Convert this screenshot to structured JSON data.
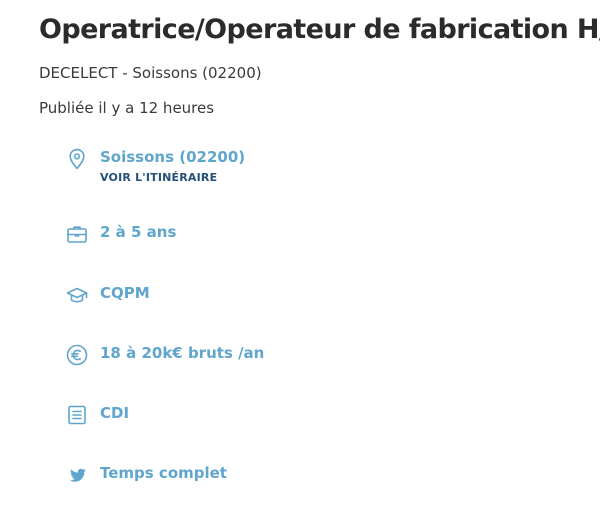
{
  "job": {
    "title": "Operatrice/Operateur de fabrication H/F",
    "company_location": "DECELECT - Soissons (02200)",
    "published": "Publiée il y a 12 heures"
  },
  "details": {
    "location": {
      "icon": "location-pin-icon",
      "value": "Soissons (02200)",
      "link_label": "VOIR L'ITINÉRAIRE"
    },
    "experience": {
      "icon": "briefcase-icon",
      "value": "2 à 5 ans"
    },
    "education": {
      "icon": "graduation-cap-icon",
      "value": "CQPM"
    },
    "salary": {
      "icon": "euro-icon",
      "value": "18 à 20k€ bruts /an"
    },
    "contract": {
      "icon": "document-icon",
      "value": "CDI"
    },
    "schedule": {
      "icon": "bird-icon",
      "value": "Temps complet"
    }
  },
  "colors": {
    "accent": "#5fa5cc",
    "link": "#24507a",
    "title": "#2b2b2b",
    "text": "#3a3a3a"
  }
}
